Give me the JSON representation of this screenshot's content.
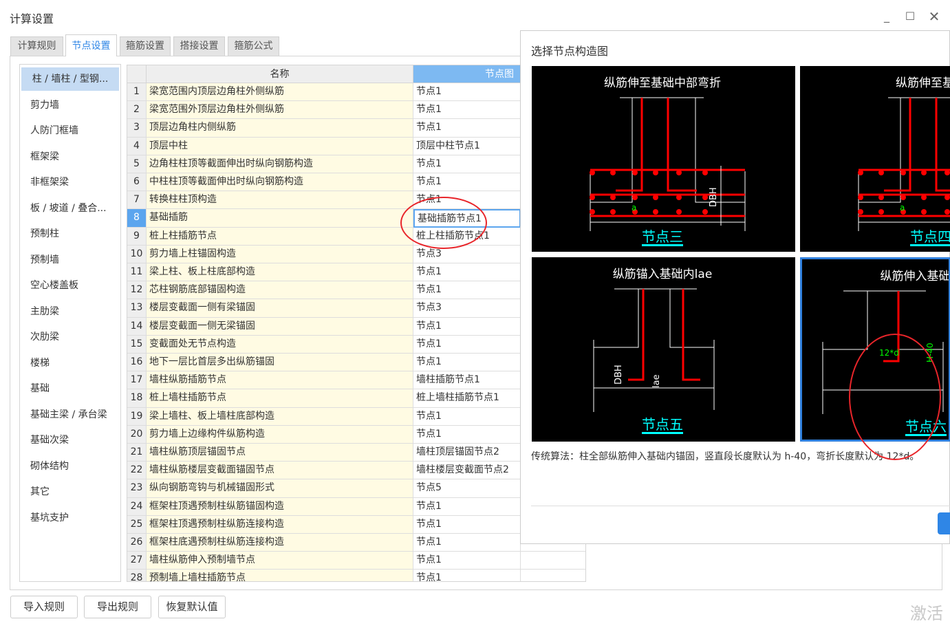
{
  "window": {
    "title": "计算设置",
    "controls": [
      "minimize",
      "maximize",
      "close"
    ]
  },
  "tabs": [
    {
      "label": "计算规则"
    },
    {
      "label": "节点设置",
      "active": true
    },
    {
      "label": "箍筋设置"
    },
    {
      "label": "搭接设置"
    },
    {
      "label": "箍筋公式"
    }
  ],
  "sidebar": {
    "items": [
      "柱 / 墙柱 / 型钢...",
      "剪力墙",
      "人防门框墙",
      "框架梁",
      "非框架梁",
      "板 / 坡道 / 叠合...",
      "预制柱",
      "预制墙",
      "空心楼盖板",
      "主肋梁",
      "次肋梁",
      "楼梯",
      "基础",
      "基础主梁 / 承台梁",
      "基础次梁",
      "砌体结构",
      "其它",
      "基坑支护"
    ],
    "selected": 0
  },
  "table": {
    "headers": {
      "name": "名称",
      "node": "节点图"
    },
    "selected_row": 8,
    "rows": [
      {
        "no": "1",
        "name": "梁宽范围内顶层边角柱外侧纵筋",
        "node": "节点1"
      },
      {
        "no": "2",
        "name": "梁宽范围外顶层边角柱外侧纵筋",
        "node": "节点1"
      },
      {
        "no": "3",
        "name": "顶层边角柱内侧纵筋",
        "node": "节点1"
      },
      {
        "no": "4",
        "name": "顶层中柱",
        "node": "顶层中柱节点1"
      },
      {
        "no": "5",
        "name": "边角柱柱顶等截面伸出时纵向钢筋构造",
        "node": "节点1"
      },
      {
        "no": "6",
        "name": "中柱柱顶等截面伸出时纵向钢筋构造",
        "node": "节点1"
      },
      {
        "no": "7",
        "name": "转换柱柱顶构造",
        "node": "节点1"
      },
      {
        "no": "8",
        "name": "基础插筋",
        "node": "基础插筋节点1"
      },
      {
        "no": "9",
        "name": "桩上柱插筋节点",
        "node": "桩上柱插筋节点1"
      },
      {
        "no": "10",
        "name": "剪力墙上柱锚固构造",
        "node": "节点3"
      },
      {
        "no": "11",
        "name": "梁上柱、板上柱底部构造",
        "node": "节点1"
      },
      {
        "no": "12",
        "name": "芯柱钢筋底部锚固构造",
        "node": "节点1"
      },
      {
        "no": "13",
        "name": "楼层变截面一侧有梁锚固",
        "node": "节点3"
      },
      {
        "no": "14",
        "name": "楼层变截面一侧无梁锚固",
        "node": "节点1"
      },
      {
        "no": "15",
        "name": "变截面处无节点构造",
        "node": "节点1"
      },
      {
        "no": "16",
        "name": "地下一层比首层多出纵筋锚固",
        "node": "节点1"
      },
      {
        "no": "17",
        "name": "墙柱纵筋插筋节点",
        "node": "墙柱插筋节点1"
      },
      {
        "no": "18",
        "name": "桩上墙柱插筋节点",
        "node": "桩上墙柱插筋节点1"
      },
      {
        "no": "19",
        "name": "梁上墙柱、板上墙柱底部构造",
        "node": "节点1"
      },
      {
        "no": "20",
        "name": "剪力墙上边缘构件纵筋构造",
        "node": "节点1"
      },
      {
        "no": "21",
        "name": "墙柱纵筋顶层锚固节点",
        "node": "墙柱顶层锚固节点2"
      },
      {
        "no": "22",
        "name": "墙柱纵筋楼层变截面锚固节点",
        "node": "墙柱楼层变截面节点2"
      },
      {
        "no": "23",
        "name": "纵向钢筋弯钩与机械锚固形式",
        "node": "节点5"
      },
      {
        "no": "24",
        "name": "框架柱顶遇预制柱纵筋锚固构造",
        "node": "节点1"
      },
      {
        "no": "25",
        "name": "框架柱顶遇预制柱纵筋连接构造",
        "node": "节点1"
      },
      {
        "no": "26",
        "name": "框架柱底遇预制柱纵筋连接构造",
        "node": "节点1"
      },
      {
        "no": "27",
        "name": "墙柱纵筋伸入预制墙节点",
        "node": "节点1"
      },
      {
        "no": "28",
        "name": "预制墙上墙柱插筋节点",
        "node": "节点1"
      }
    ]
  },
  "popup": {
    "title": "选择节点构造图",
    "diagrams": [
      {
        "caption": "纵筋伸至基础中部弯折",
        "label": "节点三",
        "dims": [
          "a",
          "DBH"
        ]
      },
      {
        "caption": "纵筋伸至基础",
        "label": "节点四",
        "dims": [
          "a"
        ]
      },
      {
        "caption": "纵筋锚入基础内lae",
        "label": "节点五",
        "dims": [
          "DBH",
          "lae"
        ]
      },
      {
        "caption": "纵筋伸入基础内一定",
        "label": "节点六",
        "dims": [
          "12*d",
          "H-40"
        ],
        "selected": true
      }
    ],
    "description": "传统算法：柱全部纵筋伸入基础内锚固，竖直段长度默认为 h-40，弯折长度默认为 12*d。"
  },
  "buttons": {
    "import": "导入规则",
    "export": "导出规则",
    "restore": "恢复默认值"
  },
  "watermark": "激活",
  "colors": {
    "accent": "#2f86e6",
    "rebar": "#ff0000",
    "dim": "#00ff00",
    "label": "#00ffff",
    "annotation": "#e8252a"
  }
}
